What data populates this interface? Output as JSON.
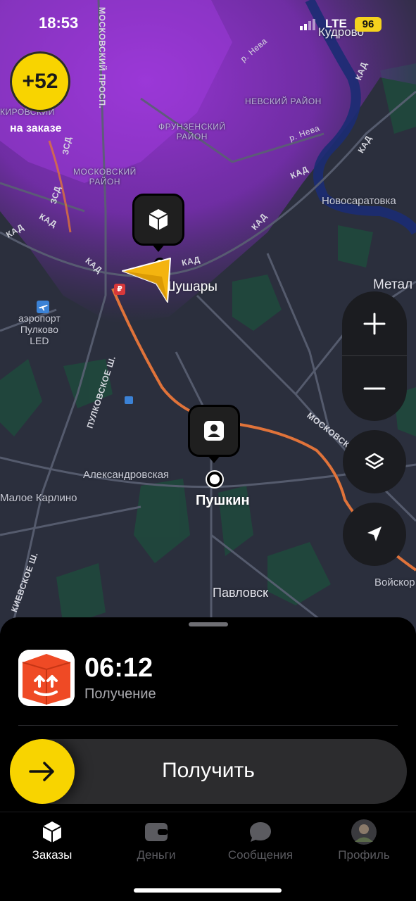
{
  "status_bar": {
    "time": "18:53",
    "network": "LTE",
    "battery": "96"
  },
  "bonus": {
    "value": "+52",
    "caption": "на заказе"
  },
  "map": {
    "places": [
      {
        "key": "kudrovo",
        "text": "Кудрово"
      },
      {
        "key": "novosaratovka",
        "text": "Новосаратовка"
      },
      {
        "key": "metal",
        "text": "Метал"
      },
      {
        "key": "shushary",
        "text": "Шушары"
      },
      {
        "key": "airport",
        "text": "аэропорт\nПулково\nLED"
      },
      {
        "key": "aleksandrovskaya",
        "text": "Александровская"
      },
      {
        "key": "maloe_karlino",
        "text": "Малое Карлино"
      },
      {
        "key": "pushkin",
        "text": "Пушкин"
      },
      {
        "key": "pavlovsk",
        "text": "Павловск"
      },
      {
        "key": "voyskor",
        "text": "Войскор"
      }
    ],
    "districts": [
      {
        "key": "nevsky",
        "text": "НЕВСКИЙ РАЙОН"
      },
      {
        "key": "frunzensky",
        "text": "ФРУНЗЕНСКИЙ\nРАЙОН"
      },
      {
        "key": "moskovsky",
        "text": "МОСКОВСКИЙ\nРАЙОН"
      },
      {
        "key": "kirovsky",
        "text": "КИРОВСКИЙ"
      }
    ],
    "roads": [
      {
        "key": "kad1",
        "text": "КАД"
      },
      {
        "key": "kad2",
        "text": "КАД"
      },
      {
        "key": "kad3",
        "text": "КАД"
      },
      {
        "key": "kad4",
        "text": "КАД"
      },
      {
        "key": "kad5",
        "text": "КАД"
      },
      {
        "key": "kad6",
        "text": "КАД"
      },
      {
        "key": "kad7",
        "text": "КАД"
      },
      {
        "key": "kad8",
        "text": "КАД"
      },
      {
        "key": "zsd",
        "text": "ЗСД"
      },
      {
        "key": "zsd2",
        "text": "ЗСД"
      },
      {
        "key": "neva1",
        "text": "р. Нева"
      },
      {
        "key": "neva2",
        "text": "р. Нева"
      },
      {
        "key": "moskovsky_prosp",
        "text": "МОСКОВСКИЙ ПРОСП."
      },
      {
        "key": "pulkovskoe",
        "text": "ПУЛКОВСКОЕ Ш."
      },
      {
        "key": "moskovskoe",
        "text": "МОСКОВСК"
      },
      {
        "key": "kievskoe",
        "text": "КИЕВСКОЕ Ш."
      }
    ],
    "icons": {
      "pickup_pin": "box-icon",
      "dropoff_pin": "person-icon",
      "courier": "navigation-arrow-icon",
      "metro": "metro-icon",
      "airport": "airplane-icon"
    }
  },
  "map_controls": {
    "zoom_in": "plus-icon",
    "zoom_out": "minus-icon",
    "layers": "layers-icon",
    "locate": "location-arrow-icon"
  },
  "order": {
    "timer": "06:12",
    "status": "Получение",
    "slide_label": "Получить"
  },
  "tabs": [
    {
      "label": "Заказы",
      "active": true
    },
    {
      "label": "Деньги",
      "active": false
    },
    {
      "label": "Сообщения",
      "active": false
    },
    {
      "label": "Профиль",
      "active": false
    }
  ],
  "colors": {
    "accent_yellow": "#f8d400",
    "map_background": "#2b2f3d",
    "surge_purple": "#8a2bc9",
    "route_orange": "#e0733a",
    "sheet_background": "#000000"
  }
}
